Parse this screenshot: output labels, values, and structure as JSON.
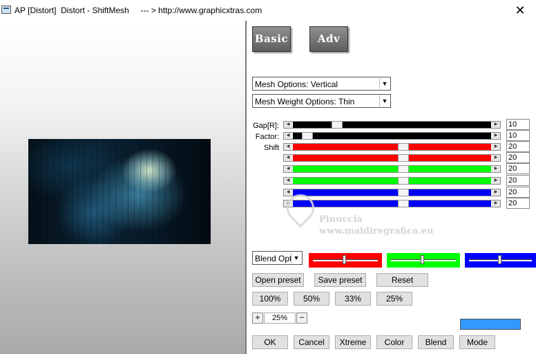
{
  "window": {
    "title": "AP [Distort]  Distort - ShiftMesh     --- > http://www.graphicxtras.com",
    "close_label": "✕"
  },
  "modes": {
    "basic": "Basic",
    "adv": "Adv"
  },
  "mesh_options": {
    "selected": "Mesh Options: Vertical"
  },
  "mesh_weight_options": {
    "selected": "Mesh Weight Options: Thin"
  },
  "params": {
    "gap": {
      "label": "Gap[R]:",
      "value": "10",
      "color": "#000000"
    },
    "factor": {
      "label": "Factor:",
      "value": "10",
      "color": "#000000"
    },
    "shift_label": "Shift",
    "shifts": [
      {
        "value": "20",
        "color": "#ff0000"
      },
      {
        "value": "20",
        "color": "#ff0000"
      },
      {
        "value": "20",
        "color": "#00ff00"
      },
      {
        "value": "20",
        "color": "#00ff00"
      },
      {
        "value": "20",
        "color": "#0000ff"
      },
      {
        "value": "20",
        "color": "#0000ff"
      }
    ]
  },
  "watermark": {
    "line1": "Pinuccia",
    "line2": "www.maidiregrafica.eu"
  },
  "blend": {
    "selected": "Blend Optio",
    "colors": [
      "#ff0000",
      "#00ff00",
      "#0000ff"
    ]
  },
  "presets": {
    "open": "Open preset",
    "save": "Save preset",
    "reset": "Reset"
  },
  "zoom_buttons": [
    "100%",
    "50%",
    "33%",
    "25%"
  ],
  "zoom": {
    "plus": "+",
    "value": "25%",
    "minus": "−"
  },
  "accent_color": "#3399ff",
  "actions": {
    "ok": "OK",
    "cancel": "Cancel",
    "xtreme": "Xtreme",
    "color": "Color",
    "blend": "Blend",
    "mode": "Mode"
  }
}
